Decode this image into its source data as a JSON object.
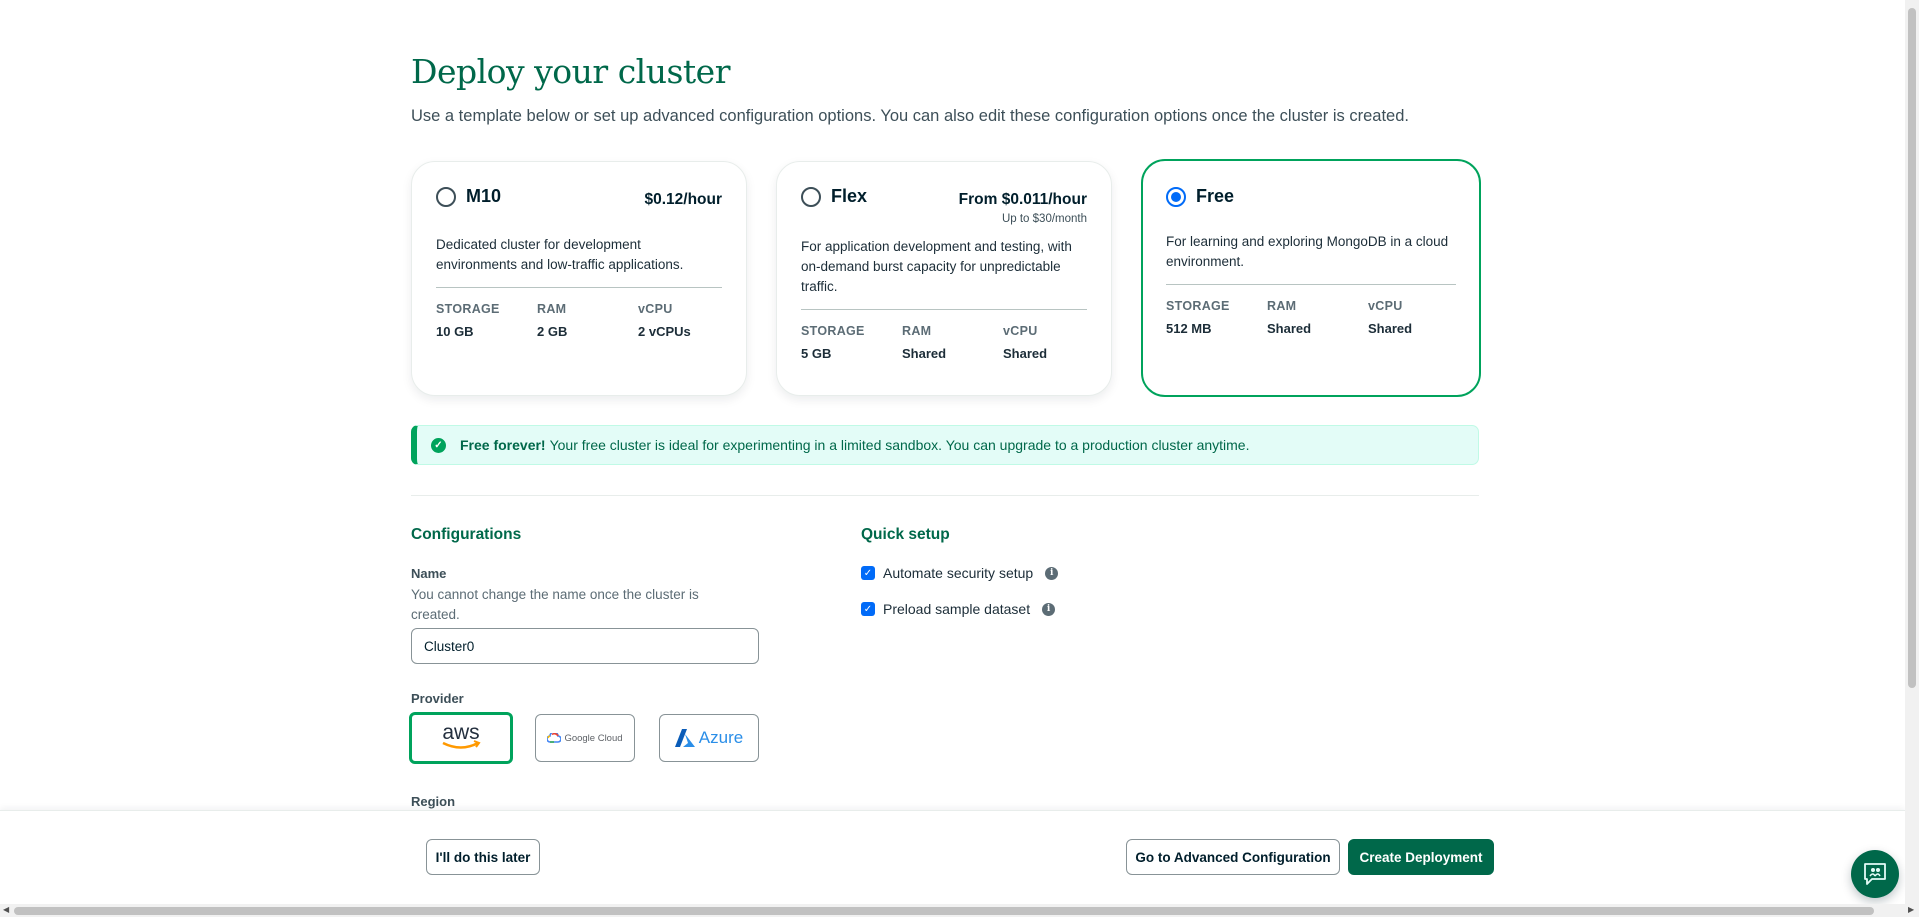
{
  "page": {
    "title": "Deploy your cluster",
    "subtitle": "Use a template below or set up advanced configuration options. You can also edit these configuration options once the cluster is created."
  },
  "tiers": [
    {
      "name": "M10",
      "price": "$0.12/hour",
      "price_sub": "",
      "description": "Dedicated cluster for development environments and low-traffic applications.",
      "selected": false,
      "specs": {
        "storage_label": "STORAGE",
        "storage": "10 GB",
        "ram_label": "RAM",
        "ram": "2 GB",
        "vcpu_label": "vCPU",
        "vcpu": "2 vCPUs"
      }
    },
    {
      "name": "Flex",
      "price": "From $0.011/hour",
      "price_sub": "Up to $30/month",
      "description": "For application development and testing, with on-demand burst capacity for unpredictable traffic.",
      "selected": false,
      "specs": {
        "storage_label": "STORAGE",
        "storage": "5 GB",
        "ram_label": "RAM",
        "ram": "Shared",
        "vcpu_label": "vCPU",
        "vcpu": "Shared"
      }
    },
    {
      "name": "Free",
      "price": "",
      "price_sub": "",
      "description": "For learning and exploring MongoDB in a cloud environment.",
      "selected": true,
      "specs": {
        "storage_label": "STORAGE",
        "storage": "512 MB",
        "ram_label": "RAM",
        "ram": "Shared",
        "vcpu_label": "vCPU",
        "vcpu": "Shared"
      }
    }
  ],
  "banner": {
    "bold": "Free forever!",
    "text": "Your free cluster is ideal for experimenting in a limited sandbox. You can upgrade to a production cluster anytime.",
    "icon": "check-circle-icon"
  },
  "configurations": {
    "title": "Configurations",
    "name_label": "Name",
    "name_help": "You cannot change the name once the cluster is created.",
    "name_value": "Cluster0",
    "provider_label": "Provider",
    "providers": [
      {
        "name": "aws",
        "selected": true
      },
      {
        "name": "Google Cloud",
        "selected": false
      },
      {
        "name": "Azure",
        "selected": false
      }
    ],
    "region_label": "Region"
  },
  "quick_setup": {
    "title": "Quick setup",
    "options": [
      {
        "label": "Automate security setup",
        "checked": true
      },
      {
        "label": "Preload sample dataset",
        "checked": true
      }
    ]
  },
  "footer": {
    "later_label": "I'll do this later",
    "advanced_label": "Go to Advanced Configuration",
    "create_label": "Create Deployment"
  },
  "colors": {
    "brand_green": "#00684a",
    "accent_green": "#00a35c",
    "radio_blue": "#016bf8"
  }
}
